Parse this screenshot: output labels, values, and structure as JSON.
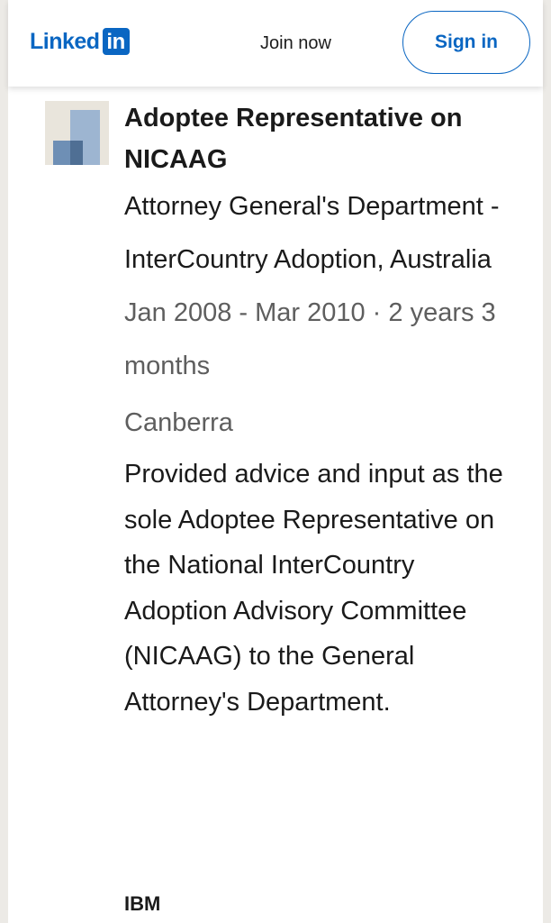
{
  "header": {
    "logo_text": "Linked",
    "logo_box_text": "in",
    "join_label": "Join now",
    "signin_label": "Sign in"
  },
  "experience": {
    "title": "Adoptee Representative on NICAAG",
    "company": "Attorney General's Department - InterCountry Adoption, Australia",
    "dates": "Jan 2008 - Mar 2010 · 2 years 3 months",
    "location": "Canberra",
    "description": "Provided advice and input as the sole Adoptee Representative on the National InterCountry Adoption Advisory Committee (NICAAG) to the General Attorney's Department."
  },
  "next_experience": {
    "company": "IBM"
  },
  "colors": {
    "brand": "#0a66c2",
    "text": "#1a1a1a",
    "muted": "#5e5e5e"
  },
  "icons": {
    "company_logo": "company-placeholder-logo-icon",
    "next_logo": "ibm-logo-icon"
  }
}
